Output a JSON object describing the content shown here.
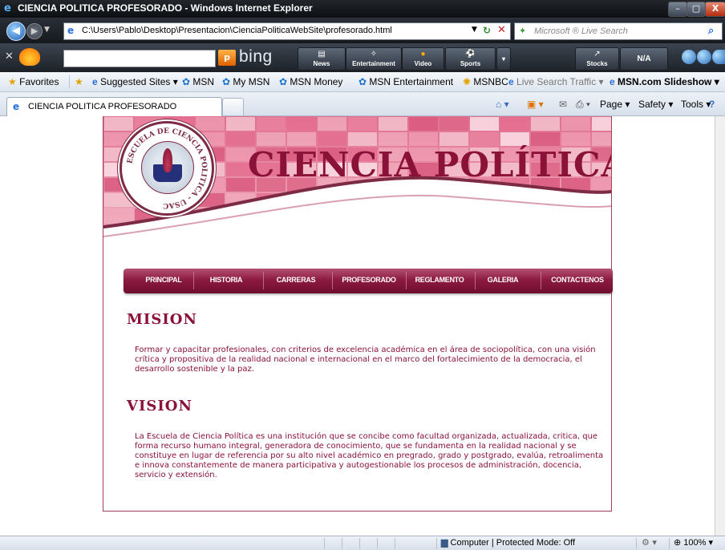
{
  "window": {
    "title": "CIENCIA POLITICA PROFESORADO - Windows Internet Explorer",
    "min": "–",
    "max": "▢",
    "close": "X"
  },
  "address_bar": {
    "url": "C:\\Users\\Pablo\\Desktop\\Presentacion\\CienciaPoliticaWebSite\\profesorado.html",
    "search_placeholder": "Microsoft ® Live Search"
  },
  "bing_toolbar": {
    "logo": "bing",
    "buttons": [
      "News",
      "Entertainment",
      "Video",
      "Sports",
      "Stocks",
      "N/A"
    ]
  },
  "favorites_bar": {
    "favorites": "Favorites",
    "items": [
      "Suggested Sites ▾",
      "MSN",
      "My MSN",
      "MSN Money",
      "MSN Entertainment",
      "MSNBC",
      "Live Search Traffic ▾",
      "MSN.com Slideshow ▾"
    ]
  },
  "tab": {
    "label": "CIENCIA POLITICA PROFESORADO"
  },
  "command_bar": {
    "page": "Page ▾",
    "safety": "Safety ▾",
    "tools": "Tools ▾"
  },
  "status_bar": {
    "zone": "Computer | Protected Mode: Off",
    "zoom": "100%"
  },
  "site": {
    "title": "CIENCIA POLÍTICA",
    "seal_text": "ESCUELA DE CIENCIA POLITICA - USAC",
    "nav": [
      "PRINCIPAL",
      "HISTORIA",
      "CARRERAS",
      "PROFESORADO",
      "REGLAMENTO",
      "GALERIA",
      "CONTACTENOS"
    ],
    "mision_heading": "MISION",
    "mision_text": "Formar y capacitar profesionales, con criterios de excelencia académica en el área de sociopolítica, con una visión crítica y propositiva de la realidad nacional e internacional en el marco del fortalecimiento de la democracia, el desarrollo sostenible y la paz.",
    "vision_heading": "VISION",
    "vision_text": "La Escuela de Ciencia Política es una institución que se concibe como facultad organizada, actualizada, critica, que forma recurso humano integral, generadora de conocimiento, que se fundamenta en la realidad nacional y se constituye en lugar de referencia por su alto nivel académico en pregrado, grado y postgrado, evalúa, retroalimenta e innova constantemente de manera participativa y autogestionable los procesos de administración, docencia, servicio y extensión."
  },
  "colors": {
    "accent": "#8a1238",
    "nav_bar": "#8c1a40",
    "banner_pink": "#e07a97"
  }
}
